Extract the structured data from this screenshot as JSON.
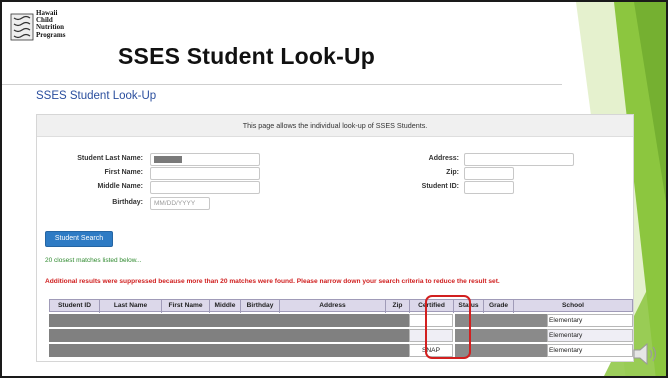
{
  "logo": {
    "lines": [
      "Hawaii",
      "Child",
      "Nutrition",
      "Programs"
    ]
  },
  "slide_title": "SSES Student Look-Up",
  "page_heading": "SSES Student Look-Up",
  "intro_text": "This page allows the individual look-up of SSES Students.",
  "form": {
    "left": [
      {
        "label": "Student Last Name:",
        "value": "",
        "placeholder": ""
      },
      {
        "label": "First Name:",
        "value": "",
        "placeholder": ""
      },
      {
        "label": "Middle Name:",
        "value": "",
        "placeholder": ""
      },
      {
        "label": "Birthday:",
        "value": "",
        "placeholder": "MM/DD/YYYY"
      }
    ],
    "right": [
      {
        "label": "Address:",
        "value": ""
      },
      {
        "label": "Zip:",
        "value": ""
      },
      {
        "label": "Student ID:",
        "value": ""
      }
    ]
  },
  "search_button": "Student Search",
  "matches_text": "20 closest matches listed below...",
  "warning_text": "Additional results were suppressed because more than 20 matches were found. Please narrow down your search criteria to reduce the result set.",
  "table": {
    "headers": [
      "Student ID",
      "Last Name",
      "First Name",
      "Middle",
      "Birthday",
      "Address",
      "Zip",
      "Certified",
      "Status",
      "Grade",
      "School"
    ],
    "rows": [
      {
        "certified": "",
        "school": "Elementary"
      },
      {
        "certified": "",
        "school": "Elementary"
      },
      {
        "certified": "SNAP",
        "school": "Elementary"
      }
    ]
  },
  "colors": {
    "accent_green": "#8cc63f",
    "highlight_red": "#d21f1f",
    "button_blue": "#2e7bc4",
    "heading_blue": "#2a4e9e"
  },
  "icons": [
    "logo-icon",
    "speaker-icon"
  ]
}
